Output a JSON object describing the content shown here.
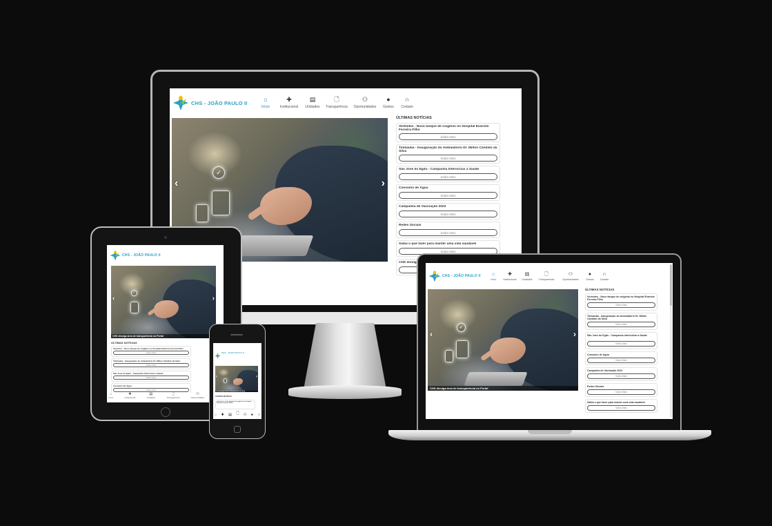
{
  "site": {
    "logo_text": "CHS - JOÃO PAULO II",
    "nav": [
      {
        "label": "Início",
        "icon": "home-icon",
        "glyph": "⌂"
      },
      {
        "label": "Institucional",
        "icon": "plus-icon",
        "glyph": "✚"
      },
      {
        "label": "Unidades",
        "icon": "building-icon",
        "glyph": "▤"
      },
      {
        "label": "Transparência",
        "icon": "document-icon",
        "glyph": "🗋"
      },
      {
        "label": "Oportunidades",
        "icon": "people-icon",
        "glyph": "⚇"
      },
      {
        "label": "Gestos",
        "icon": "globe-icon",
        "glyph": "●"
      },
      {
        "label": "Contato",
        "icon": "headset-icon",
        "glyph": "∩"
      }
    ],
    "hero_caption": "CHS divulga área de transparência no Portal",
    "prev_arrow": "‹",
    "next_arrow": "›",
    "news_title": "ÚLTIMAS NOTÍCIAS",
    "read_more": "Saiba Mais",
    "news": [
      {
        "title": "Vertentes - Novo tanque de oxigênio no Hospital Evaristo Ferreira Filho"
      },
      {
        "title": "Timbaúba - Inauguração do Ambulatório Dr. Milton Cândido da Silva"
      },
      {
        "title": "São José do Egito - Campanha Interiorizar a Saúde"
      },
      {
        "title": "Consumo de Água"
      },
      {
        "title": "Campanha de Vacinação 2023"
      },
      {
        "title": "Redes Sociais"
      },
      {
        "title": "Saiba o que fazer para manter uma vida saudável"
      },
      {
        "title": "CHS divulga área de transparência no Portal"
      }
    ]
  },
  "colors": {
    "background": "#0c0c0c",
    "brand_blue": "#2a9fc4",
    "logo_green": "#8dc63f",
    "logo_yellow": "#f2c200"
  }
}
